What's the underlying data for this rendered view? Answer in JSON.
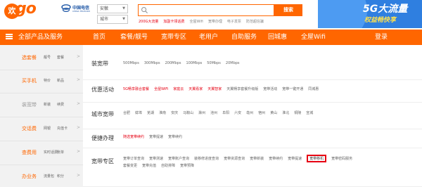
{
  "header": {
    "logo_text": "欢go",
    "telecom_name": "中国电信",
    "telecom_sub": "CHINA TELECOM",
    "province_select": "安徽",
    "city_select": "城市",
    "search_placeholder": "",
    "search_button": "搜索",
    "hot_words": [
      {
        "text": "200G大流量",
        "color": "#e60012"
      },
      {
        "text": "加副卡领话费",
        "color": "#e60012"
      },
      {
        "text": "全屋Wifi",
        "color": "#888888"
      },
      {
        "text": "宽带办理",
        "color": "#888888"
      },
      {
        "text": "电子发票",
        "color": "#888888"
      },
      {
        "text": "防范超信骗",
        "color": "#888888"
      }
    ],
    "banner_big": "5G大流量",
    "banner_small": "权益畅快享"
  },
  "nav": {
    "all_products": "全部产品及服务",
    "items": [
      "首页",
      "套餐/靓号",
      "宽带专区",
      "老用户",
      "自助服务",
      "回城惠",
      "全屋Wifi",
      "登录"
    ]
  },
  "sidebar": {
    "rows": [
      {
        "category": "选套餐",
        "sub1": "靓号",
        "sub2": "套餐",
        "active": true
      },
      {
        "category": "买手机",
        "sub1": "特价",
        "sub2": "新品",
        "active": true
      },
      {
        "category": "装宽带",
        "sub1": "新装",
        "sub2": "续费",
        "active": false
      },
      {
        "category": "交话费",
        "sub1": "网银",
        "sub2": "充值卡",
        "active": true
      },
      {
        "category": "查费用",
        "sub1": "实时话费",
        "sub2": "账单",
        "active": true
      },
      {
        "category": "办业务",
        "sub1": "流量包",
        "sub2": "积分",
        "active": true
      }
    ],
    "arrow": ">"
  },
  "main": {
    "rows": [
      {
        "label": "装宽带",
        "items": [
          {
            "text": "500Mbps"
          },
          {
            "text": "300Mbps"
          },
          {
            "text": "200Mbps"
          },
          {
            "text": "100Mbps"
          },
          {
            "text": "50Mbps"
          },
          {
            "text": "20Mbps"
          }
        ]
      },
      {
        "label": "优惠活动",
        "items": [
          {
            "text": "5G畅享融合套餐",
            "red": true
          },
          {
            "text": "全屋WiFi",
            "red": true
          },
          {
            "text": "家庭云",
            "red": true
          },
          {
            "text": "天翼看家",
            "red": true
          },
          {
            "text": "天翼智家",
            "red": true
          },
          {
            "text": "天翼畅享套餐升级版"
          },
          {
            "text": "宽带活动"
          },
          {
            "text": "宽带一键开通"
          },
          {
            "text": "同城惠"
          }
        ]
      },
      {
        "label": "城市宽带",
        "items": [
          {
            "text": "合肥"
          },
          {
            "text": "蚌埠"
          },
          {
            "text": "芜湖"
          },
          {
            "text": "淮南"
          },
          {
            "text": "安庆"
          },
          {
            "text": "马鞍山"
          },
          {
            "text": "滁州"
          },
          {
            "text": "池州"
          },
          {
            "text": "阜阳"
          },
          {
            "text": "六安"
          },
          {
            "text": "亳州"
          },
          {
            "text": "宿州"
          },
          {
            "text": "黄山"
          },
          {
            "text": "淮北"
          },
          {
            "text": "铜陵"
          },
          {
            "text": "宣城"
          }
        ]
      },
      {
        "label": "便捷办理",
        "items": [
          {
            "text": "随选宽带续约",
            "red": true
          },
          {
            "text": "宽带提速"
          },
          {
            "text": "宽带续约"
          }
        ]
      },
      {
        "label": "宽带专区",
        "items": [
          {
            "text": "宽带订单查询"
          },
          {
            "text": "宽带测速"
          },
          {
            "text": "宽带账户查询"
          },
          {
            "text": "装移修进度查询"
          },
          {
            "text": "宽带资源查询"
          },
          {
            "text": "宽带新装"
          },
          {
            "text": "宽带续约"
          },
          {
            "text": "宽带提速"
          },
          {
            "text": "宽带移机",
            "boxed": true
          },
          {
            "text": "宽带密码服务"
          }
        ],
        "items_line2": [
          {
            "text": "套餐变更"
          },
          {
            "text": "宽带充值"
          },
          {
            "text": "自助排障"
          },
          {
            "text": "宽带预降"
          }
        ]
      }
    ]
  }
}
